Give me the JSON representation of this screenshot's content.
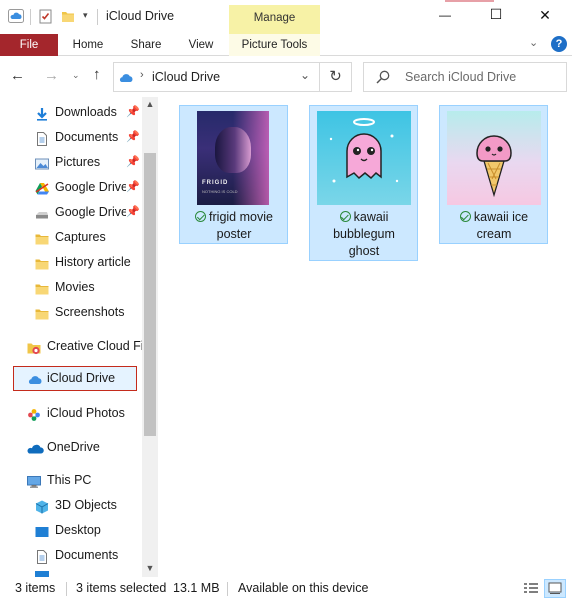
{
  "window": {
    "title": "iCloud Drive",
    "manage_label": "Manage",
    "controls": {
      "minimize": "—",
      "maximize": "☐",
      "close": "✕"
    }
  },
  "ribbon": {
    "tabs": [
      "File",
      "Home",
      "Share",
      "View",
      "Picture Tools"
    ],
    "help": "?"
  },
  "address": {
    "path": "iCloud Drive",
    "search_placeholder": "Search iCloud Drive"
  },
  "nav_pane": {
    "quick_access": [
      {
        "label": "Downloads",
        "icon": "download-arrow-icon",
        "pinned": true
      },
      {
        "label": "Documents",
        "icon": "documents-icon",
        "pinned": true
      },
      {
        "label": "Pictures",
        "icon": "pictures-icon",
        "pinned": true
      },
      {
        "label": "Google Drive",
        "icon": "google-drive-icon",
        "pinned": true
      },
      {
        "label": "Google Drive",
        "icon": "google-drive-icon",
        "pinned": true
      },
      {
        "label": "Captures",
        "icon": "folder-icon",
        "pinned": false
      },
      {
        "label": "History article",
        "icon": "folder-icon",
        "pinned": false
      },
      {
        "label": "Movies",
        "icon": "folder-icon",
        "pinned": false
      },
      {
        "label": "Screenshots",
        "icon": "folder-icon",
        "pinned": false
      }
    ],
    "creative_cloud": "Creative Cloud Fi",
    "icloud_drive": "iCloud Drive",
    "icloud_photos": "iCloud Photos",
    "onedrive": "OneDrive",
    "this_pc": "This PC",
    "pc_items": [
      "3D Objects",
      "Desktop",
      "Documents"
    ]
  },
  "files": [
    {
      "name_line1": "frigid movie",
      "name_line2": "poster",
      "name_line3": "",
      "status": "available-check-icon"
    },
    {
      "name_line1": "kawaii",
      "name_line2": "bubblegum",
      "name_line3": "ghost",
      "status": "available-check-icon"
    },
    {
      "name_line1": "kawaii ice",
      "name_line2": "cream",
      "name_line3": "",
      "status": "available-check-icon"
    }
  ],
  "poster": {
    "title": "FRIGID",
    "tagline": "NOTHING IS COLD"
  },
  "status": {
    "count": "3 items",
    "selected": "3 items selected",
    "size": "13.1 MB",
    "availability": "Available on this device"
  },
  "colors": {
    "accent": "#1e7ed8",
    "file_tab": "#a4262c",
    "manage_tab": "#f7f2a6",
    "selection": "#cce8ff",
    "selection_border": "#99d1ff",
    "nav_selected_border": "#c42b1c"
  }
}
